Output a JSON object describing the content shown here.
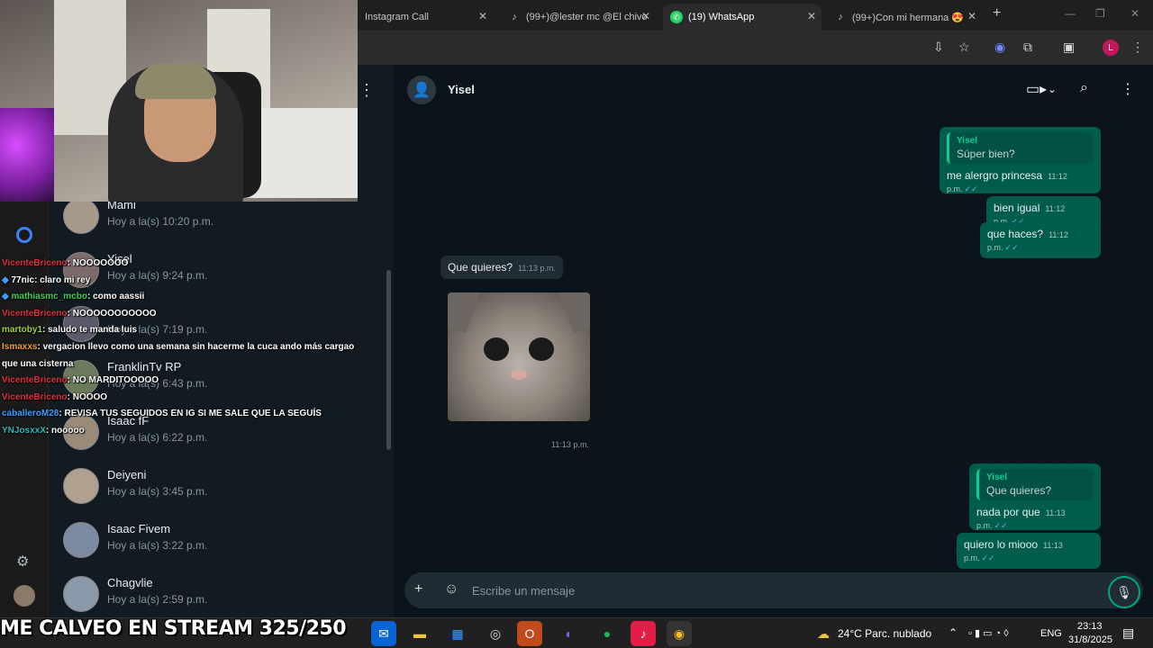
{
  "browser": {
    "tabs": [
      {
        "label": "Instagram Call"
      },
      {
        "label": "(99+)@lester mc @El chivo"
      },
      {
        "label": "(19) WhatsApp"
      },
      {
        "label": "(99+)Con mi hermana 😍"
      }
    ],
    "new_tab": "+",
    "profile_initial": "L"
  },
  "contacts": [
    {
      "name": "Mami",
      "time": "Hoy a la(s) 10:20 p.m."
    },
    {
      "name": "Yisel",
      "time": "Hoy a la(s) 9:24 p.m."
    },
    {
      "name": "",
      "time": "Hoy a la(s) 7:19 p.m."
    },
    {
      "name": "FranklinTv RP",
      "time": "Hoy a la(s) 6:43 p.m."
    },
    {
      "name": "Isaac fF",
      "time": "Hoy a la(s) 6:22 p.m."
    },
    {
      "name": "Deiyeni",
      "time": "Hoy a la(s) 3:45 p.m."
    },
    {
      "name": "Isaac Fivem",
      "time": "Hoy a la(s) 3:22 p.m."
    },
    {
      "name": "Chagvlie",
      "time": "Hoy a la(s) 2:59 p.m."
    }
  ],
  "stream_chat": [
    {
      "user": "VicenteBriceno",
      "color": "#e0313d",
      "msg": ": NOOOOOOO"
    },
    {
      "user": "77nic",
      "color": "#ffffff",
      "msg": ": claro mi rey"
    },
    {
      "user": "mathiasmc_mcbo",
      "color": "#39d353",
      "msg": ": como aassii"
    },
    {
      "user": "VicenteBriceno",
      "color": "#e0313d",
      "msg": ": NOOOOOOOOOOO"
    },
    {
      "user": "martoby1",
      "color": "#9ad14b",
      "msg": ": saludo te manda luis"
    },
    {
      "user": "Ismaxxs",
      "color": "#f0a020",
      "msg": ": vergacion llevo como una semana sin hacerme la cuca ando más cargao que una cisterna"
    },
    {
      "user": "VicenteBriceno",
      "color": "#e0313d",
      "msg": ": NO MARDITOOOOO"
    },
    {
      "user": "VicenteBriceno",
      "color": "#e0313d",
      "msg": ": NOOOO"
    },
    {
      "user": "caballeroM28",
      "color": "#3aa0ff",
      "msg": ": REVISA TUS SEGUIDOS EN IG SI ME SALE QUE LA SEGUÍS"
    },
    {
      "user": "YNJosxxX",
      "color": "#2fb5b5",
      "msg": ": nooooo"
    }
  ],
  "chat": {
    "contact_name": "Yisel",
    "composer_placeholder": "Escribe un mensaje",
    "messages": {
      "m1_quote_name": "Yisel",
      "m1_quote_text": "Súper bien?",
      "m1_text": "me alergro princesa",
      "m1_time": "11:12 p.m.",
      "m2_text": "bien igual",
      "m2_time": "11:12 p.m.",
      "m3_text": "que haces?",
      "m3_time": "11:12 p.m.",
      "m4_text": "Que quieres?",
      "m4_time": "11:13 p.m.",
      "image_time": "11:13 p.m.",
      "m5_quote_name": "Yisel",
      "m5_quote_text": "Que quieres?",
      "m5_text": "nada por que",
      "m5_time": "11:13 p.m.",
      "m6_text": "quiero lo miooo",
      "m6_time": "11:13 p.m."
    }
  },
  "overlay": {
    "stream_counter": "ME CALVEO EN STREAM 325/250"
  },
  "taskbar": {
    "weather": "24°C  Parc. nublado",
    "language": "ENG",
    "time": "23:13",
    "date": "31/8/2025"
  },
  "colors": {
    "accent": "#00a884",
    "outgoing_bubble": "#005c4b",
    "incoming_bubble": "#202c33",
    "read_ticks": "#53bdeb"
  }
}
